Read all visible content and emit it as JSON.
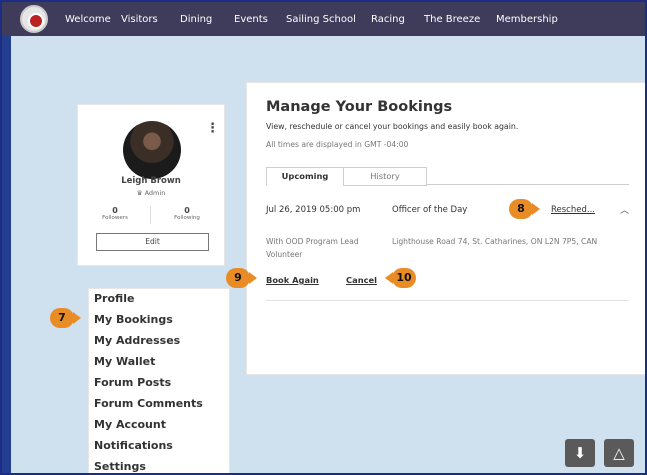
{
  "nav": {
    "logo_icon": "club-logo-icon",
    "items": [
      "Welcome",
      "Visitors",
      "Dining",
      "Events",
      "Sailing School",
      "Racing",
      "The Breeze",
      "Membership"
    ]
  },
  "profile": {
    "name": "Leigh Brown",
    "role": "Admin",
    "role_icon": "crown-icon",
    "followers_count": "0",
    "followers_label": "Followers",
    "following_count": "0",
    "following_label": "Following",
    "edit_label": "Edit",
    "menu_icon": "kebab-icon"
  },
  "menu": {
    "items": [
      "Profile",
      "My Bookings",
      "My Addresses",
      "My Wallet",
      "Forum Posts",
      "Forum Comments",
      "My Account",
      "Notifications",
      "Settings"
    ]
  },
  "bookings": {
    "title": "Manage Your Bookings",
    "subtitle": "View, reschedule or cancel your bookings and easily book again.",
    "timezone_note": "All times are displayed in GMT -04:00",
    "tabs": [
      "Upcoming",
      "History"
    ],
    "item": {
      "date": "Jul 26, 2019 05:00 pm",
      "event": "Officer of the Day",
      "reschedule": "Resched...",
      "group": "With OOD Program Lead Volunteer",
      "address": "Lighthouse Road 74, St. Catharines, ON L2N 7P5, CAN",
      "book_again": "Book Again",
      "cancel": "Cancel"
    }
  },
  "callouts": [
    "7",
    "8",
    "9",
    "10"
  ],
  "floating": {
    "download_icon": "download-icon",
    "drive_icon": "drive-icon"
  },
  "colors": {
    "topbar": "#3e3c5a",
    "page_bg": "#cfe0ee",
    "callout": "#ea8c26",
    "frame": "#1c2d86"
  }
}
